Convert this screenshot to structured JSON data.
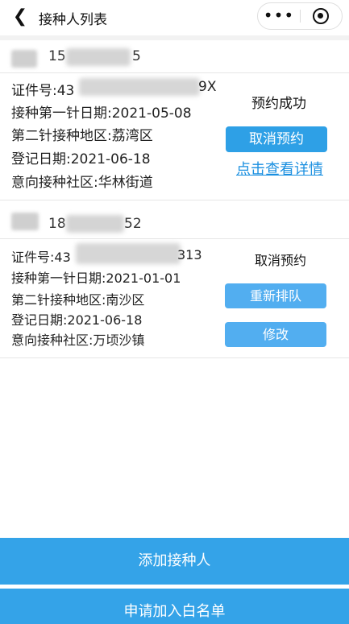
{
  "header": {
    "title": "接种人列表",
    "back_icon": "chevron-left-icon",
    "more_icon": "more-dots-icon",
    "close_icon": "target-circle-icon",
    "more_label": "•••"
  },
  "persons": [
    {
      "phone_prefix": "15",
      "phone_suffix": "5",
      "id_label": "证件号:",
      "id_prefix": "43",
      "id_suffix": "9X",
      "first_dose_date": "接种第一针日期:2021-05-08",
      "second_dose_area": "第二针接种地区:荔湾区",
      "register_date": "登记日期:2021-06-18",
      "community": "意向接种社区:华林街道",
      "status": "预约成功",
      "action_1": "取消预约",
      "link": "点击查看详情"
    },
    {
      "phone_prefix": "18",
      "phone_suffix": "52",
      "id_label": "证件号:",
      "id_prefix": "43",
      "id_suffix": "313",
      "first_dose_date": "接种第一针日期:2021-01-01",
      "second_dose_area": "第二针接种地区:南沙区",
      "register_date": "登记日期:2021-06-18",
      "community": "意向接种社区:万顷沙镇",
      "status": "取消预约",
      "action_1": "重新排队",
      "action_2": "修改"
    }
  ],
  "footer": {
    "add_person": "添加接种人",
    "apply_whitelist": "申请加入白名单"
  },
  "colors": {
    "accent": "#2ea0e6",
    "link": "#1a8fe0",
    "bottom_button": "#34a3e8"
  }
}
